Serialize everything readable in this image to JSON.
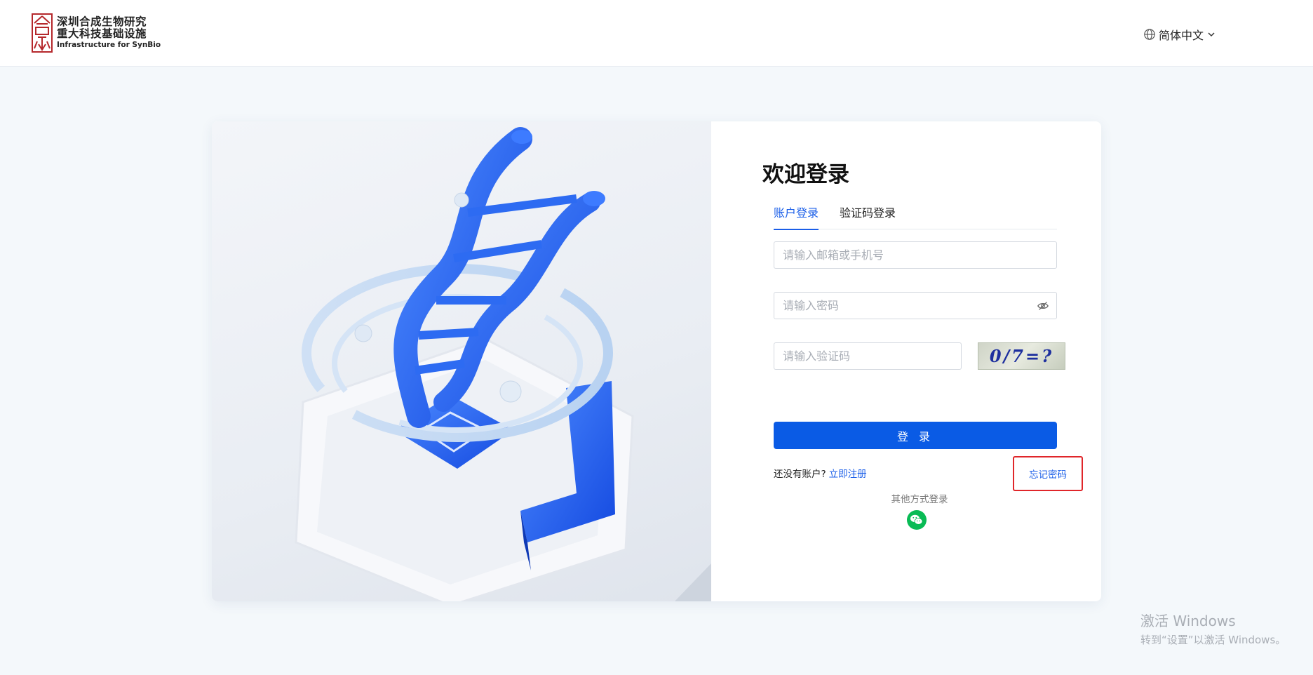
{
  "header": {
    "logo": {
      "line1": "深圳合成生物研究",
      "line2": "重大科技基础设施",
      "line3": "Infrastructure for SynBio",
      "seal_color": "#b5282c"
    },
    "language": {
      "label": "简体中文",
      "icon": "globe-icon"
    }
  },
  "login": {
    "title": "欢迎登录",
    "tabs": [
      {
        "label": "账户登录",
        "active": true
      },
      {
        "label": "验证码登录",
        "active": false
      }
    ],
    "account": {
      "placeholder": "请输入邮箱或手机号",
      "value": ""
    },
    "password": {
      "placeholder": "请输入密码",
      "value": "",
      "toggle_icon": "eye-slash-icon"
    },
    "captcha": {
      "placeholder": "请输入验证码",
      "value": "",
      "image_text": "0/7=?"
    },
    "submit_label": "登 录",
    "no_account_text": "还没有账户?",
    "register_label": "立即注册",
    "forgot_label": "忘记密码",
    "other_login_label": "其他方式登录",
    "wechat_icon": "wechat-icon"
  },
  "watermark": {
    "line1": "激活 Windows",
    "line2": "转到“设置”以激活 Windows。"
  },
  "colors": {
    "primary": "#0a5be5",
    "link": "#1a5ee8",
    "highlight_border": "#e0262a",
    "wechat": "#09bb55"
  }
}
